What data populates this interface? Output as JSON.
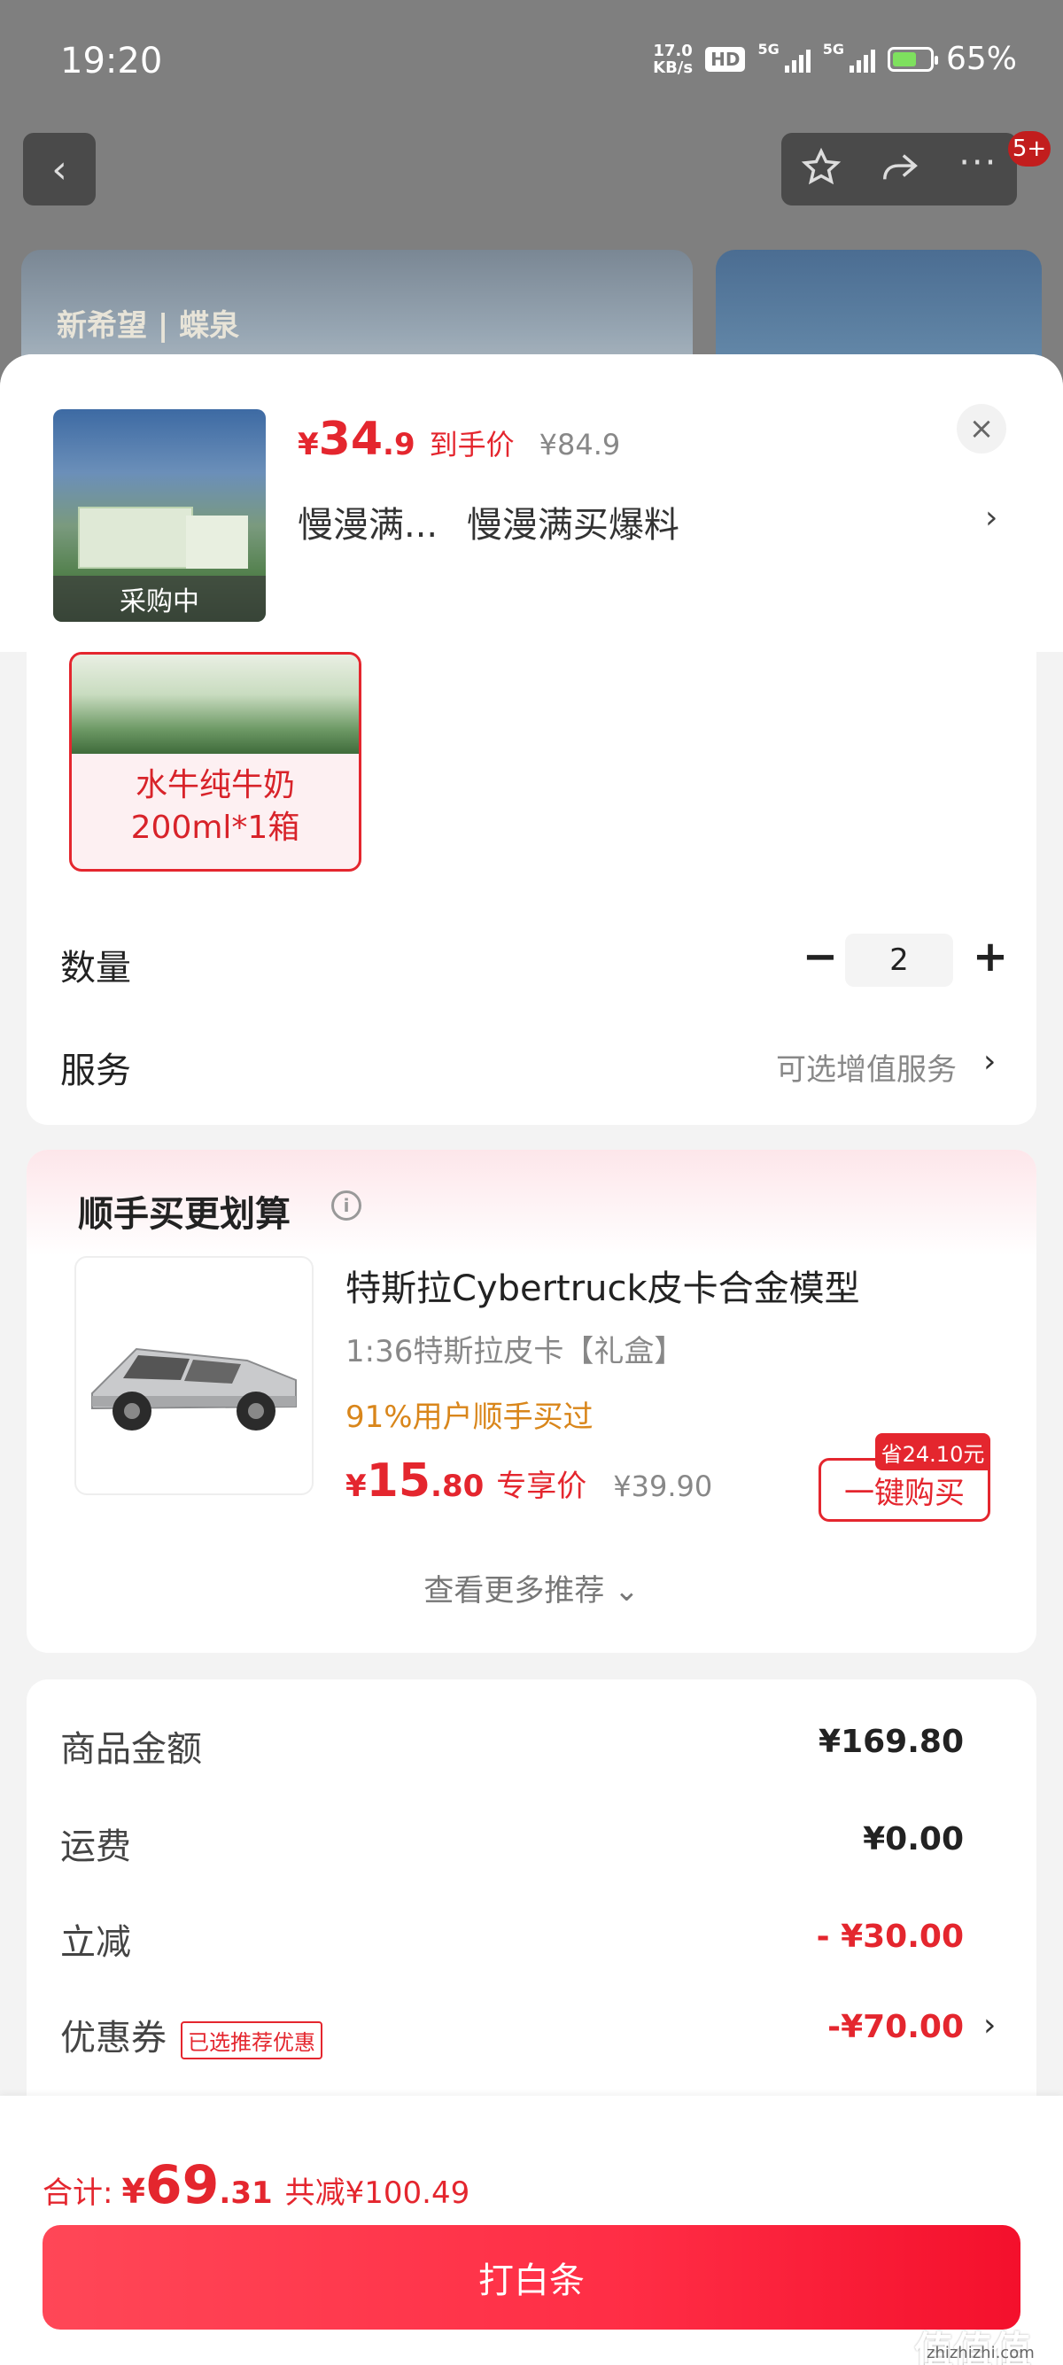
{
  "status": {
    "time": "19:20",
    "net_speed_value": "17.0",
    "net_speed_unit": "KB/s",
    "hd": "HD",
    "sig1": "5G",
    "sig2": "5G",
    "battery": "65%",
    "battery_level": 0.65
  },
  "nav": {
    "badge": "5+"
  },
  "banner": {
    "logo_text": "新希望 | 蝶泉"
  },
  "product": {
    "thumb_status": "采购中",
    "price_currency": "¥",
    "price_int": "34",
    "price_dec": ".9",
    "price_label": "到手价",
    "orig_price": "¥84.9",
    "promo_tag": "慢漫满...",
    "promo_text": "慢漫满买爆料",
    "close": "×"
  },
  "spec": {
    "variant_label": "水牛纯牛奶\n200ml*1箱",
    "quantity_label": "数量",
    "quantity_value": "2",
    "service_label": "服务",
    "service_value": "可选增值服务"
  },
  "addon": {
    "title": "顺手买更划算",
    "name": "特斯拉Cybertruck皮卡合金模型",
    "subtitle": "1:36特斯拉皮卡【礼盒】",
    "social": "91%用户顺手买过",
    "price_currency": "¥",
    "price_int": "15",
    "price_dec": ".80",
    "price_label": "专享价",
    "orig_price": "¥39.90",
    "save_tag": "省24.10元",
    "buy_button": "一键购买",
    "see_more": "查看更多推荐 ⌄"
  },
  "summary": {
    "items": [
      {
        "label": "商品金额",
        "value": "¥169.80"
      },
      {
        "label": "运费",
        "value": "¥0.00"
      },
      {
        "label": "立减",
        "value": "- ¥30.00"
      },
      {
        "label": "优惠券",
        "value": "-¥70.00",
        "tag": "已选推荐优惠"
      }
    ]
  },
  "footer": {
    "total_label": "合计:",
    "total_currency": "¥",
    "total_int": "69",
    "total_dec": ".31",
    "total_saved": "共减¥100.49",
    "pay_button": "打白条",
    "watermark": "值值值",
    "watermark_sub": "zhizhizhi.com"
  },
  "colors": {
    "accent": "#e4262e",
    "social": "#d9861b"
  }
}
